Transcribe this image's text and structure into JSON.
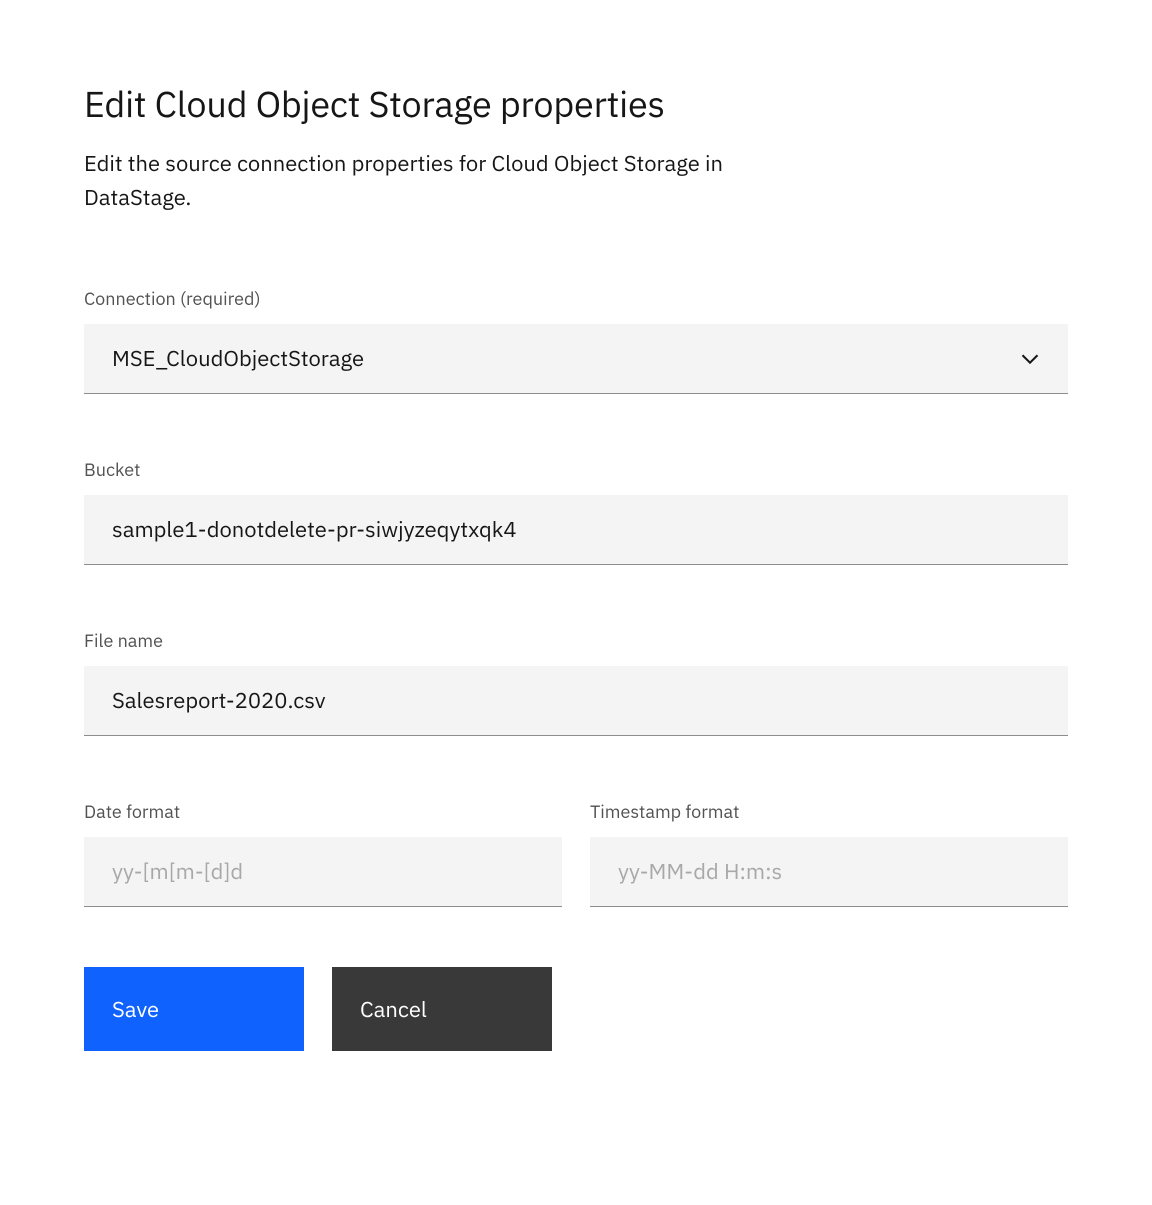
{
  "header": {
    "title": "Edit Cloud Object Storage properties",
    "subtitle": "Edit the source connection properties for Cloud Object Storage in DataStage."
  },
  "fields": {
    "connection": {
      "label": "Connection (required)",
      "value": "MSE_CloudObjectStorage"
    },
    "bucket": {
      "label": "Bucket",
      "value": "sample1-donotdelete-pr-siwjyzeqytxqk4"
    },
    "filename": {
      "label": "File name",
      "value": "Salesreport-2020.csv"
    },
    "dateformat": {
      "label": "Date format",
      "placeholder": "yy-[m[m-[d]d",
      "value": ""
    },
    "timestampformat": {
      "label": "Timestamp format",
      "placeholder": "yy-MM-dd H:m:s",
      "value": ""
    }
  },
  "buttons": {
    "save": "Save",
    "cancel": "Cancel"
  }
}
